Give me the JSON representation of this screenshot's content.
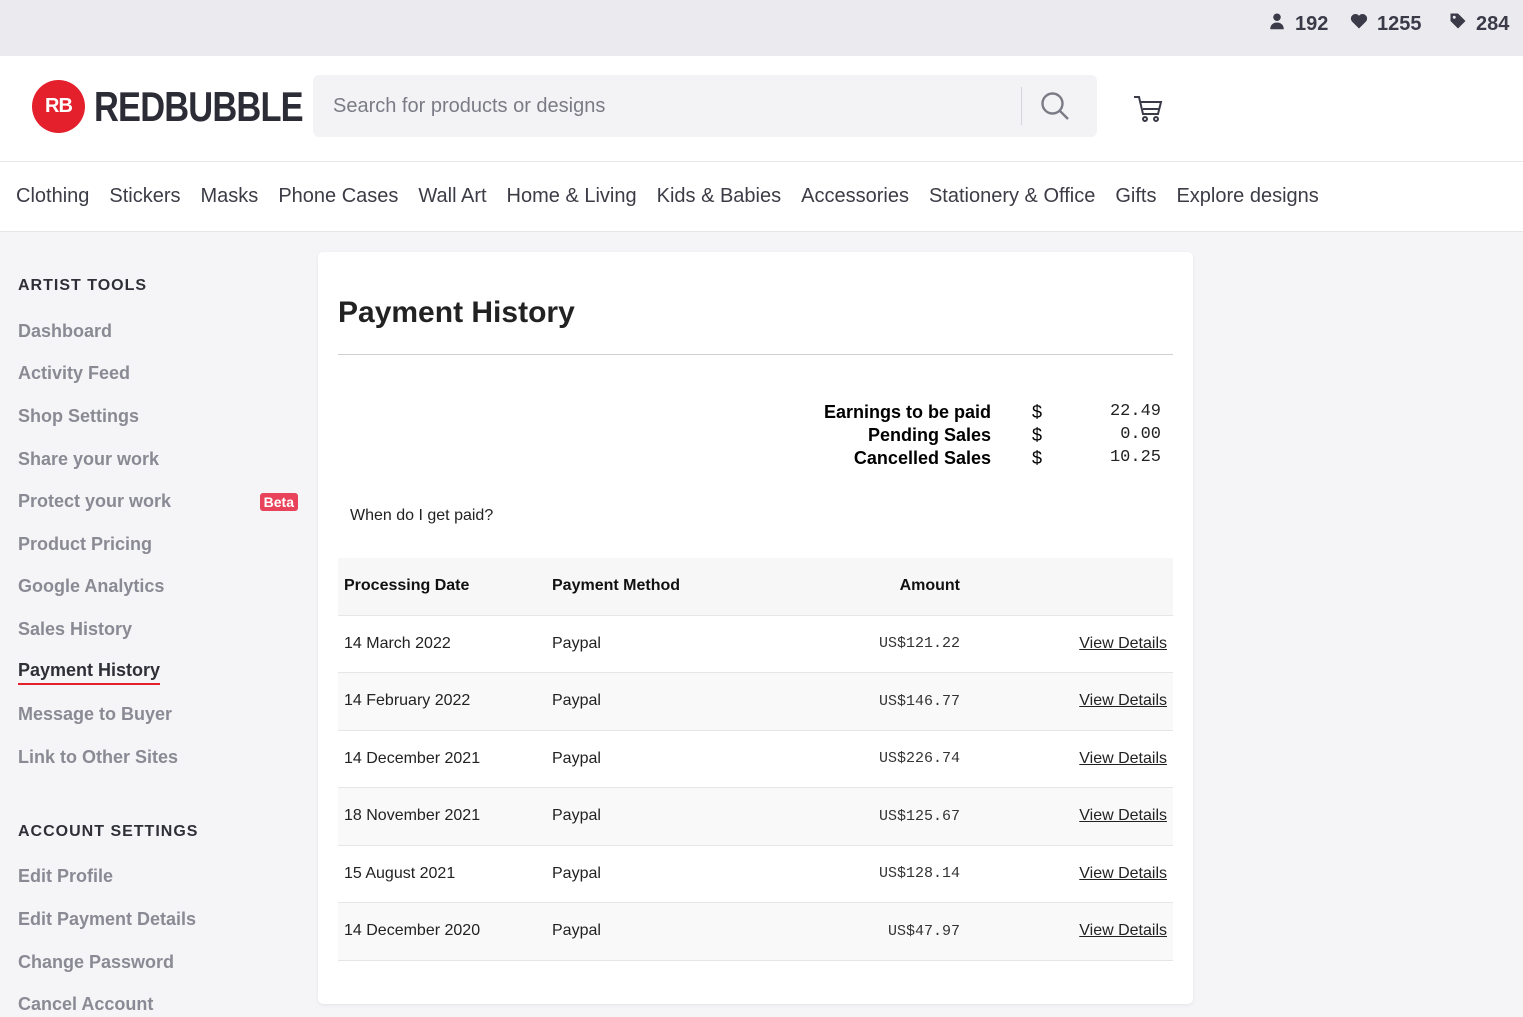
{
  "stats": {
    "followers": "192",
    "likes": "1255",
    "tags": "284"
  },
  "header": {
    "logo_mark": "RB",
    "logo_text": "REDBUBBLE",
    "search_placeholder": "Search for products or designs"
  },
  "categories": [
    "Clothing",
    "Stickers",
    "Masks",
    "Phone Cases",
    "Wall Art",
    "Home & Living",
    "Kids & Babies",
    "Accessories",
    "Stationery & Office",
    "Gifts",
    "Explore designs"
  ],
  "sidebar": {
    "artist_tools_heading": "ARTIST TOOLS",
    "artist_tools": [
      {
        "label": "Dashboard"
      },
      {
        "label": "Activity Feed"
      },
      {
        "label": "Shop Settings"
      },
      {
        "label": "Share your work"
      },
      {
        "label": "Protect your work",
        "badge": "Beta"
      },
      {
        "label": "Product Pricing"
      },
      {
        "label": "Google Analytics"
      },
      {
        "label": "Sales History"
      },
      {
        "label": "Payment History",
        "active": true
      },
      {
        "label": "Message to Buyer"
      },
      {
        "label": "Link to Other Sites"
      }
    ],
    "account_heading": "ACCOUNT SETTINGS",
    "account": [
      {
        "label": "Edit Profile"
      },
      {
        "label": "Edit Payment Details"
      },
      {
        "label": "Change Password"
      },
      {
        "label": "Cancel Account"
      }
    ]
  },
  "main": {
    "title": "Payment History",
    "summary": [
      {
        "label": "Earnings to be paid",
        "currency": "$",
        "value": "22.49"
      },
      {
        "label": "Pending Sales",
        "currency": "$",
        "value": "0.00"
      },
      {
        "label": "Cancelled Sales",
        "currency": "$",
        "value": "10.25"
      }
    ],
    "when_paid": "When do I get paid?",
    "table": {
      "headers": [
        "Processing Date",
        "Payment Method",
        "Amount"
      ],
      "rows": [
        {
          "date": "14 March 2022",
          "method": "Paypal",
          "amount": "US$121.22",
          "action": "View Details"
        },
        {
          "date": "14 February 2022",
          "method": "Paypal",
          "amount": "US$146.77",
          "action": "View Details"
        },
        {
          "date": "14 December 2021",
          "method": "Paypal",
          "amount": "US$226.74",
          "action": "View Details"
        },
        {
          "date": "18 November 2021",
          "method": "Paypal",
          "amount": "US$125.67",
          "action": "View Details"
        },
        {
          "date": "15 August 2021",
          "method": "Paypal",
          "amount": "US$128.14",
          "action": "View Details"
        },
        {
          "date": "14 December 2020",
          "method": "Paypal",
          "amount": "US$47.97",
          "action": "View Details"
        }
      ]
    }
  },
  "colors": {
    "brand": "#e4202d",
    "beta_badge": "#e8435a"
  }
}
